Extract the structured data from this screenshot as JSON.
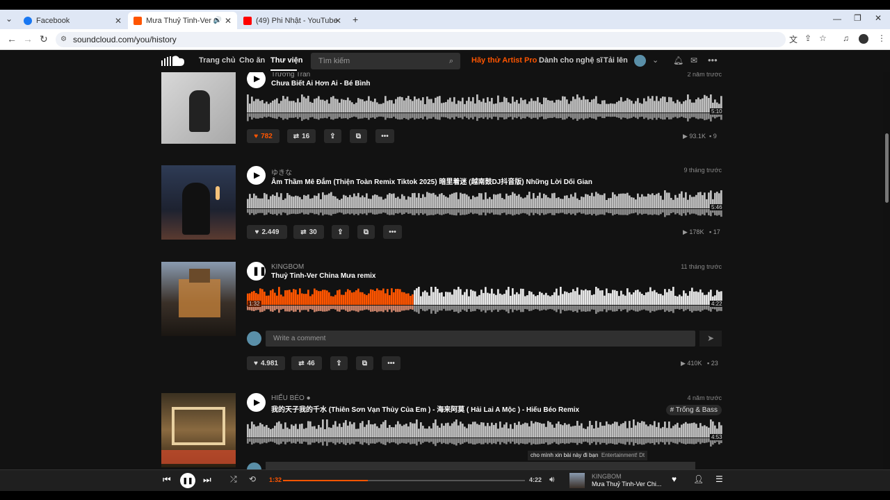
{
  "browser": {
    "tabs": [
      {
        "label": "Facebook"
      },
      {
        "label": "Mưa Thuỷ Tinh-Ver China m"
      },
      {
        "label": "(49) Phi Nhật - YouTube"
      }
    ],
    "url": "soundcloud.com/you/history"
  },
  "nav": {
    "home": "Trang chủ",
    "feed": "Cho ăn",
    "library": "Thư viện",
    "search_placeholder": "Tìm kiếm",
    "artist_pro": "Hãy thử Artist Pro",
    "for_artists": "Dành cho nghệ sĩ",
    "upload": "Tải lên"
  },
  "tracks": [
    {
      "artist": "Trương Trần",
      "title": "Chưa Biết Ai Hơn Ai - Bé Bình",
      "time": "2 năm trước",
      "duration": "5:10",
      "likes": "782",
      "reposts": "16",
      "plays": "93.1K",
      "comments": "9"
    },
    {
      "artist": "ゆきな",
      "title": "Âm Thầm Mê Đắm (Thiện Toàn Remix Tiktok 2025) 暗里着迷 (越南鼓DJ抖音版) Những Lời Dối Gian",
      "time": "9 tháng trước",
      "duration": "5:46",
      "likes": "2.449",
      "reposts": "30",
      "plays": "178K",
      "comments": "17"
    },
    {
      "artist": "KINGBOM",
      "title": "Thuỷ Tinh-Ver China Mưa remix",
      "time": "11 tháng trước",
      "elapsed": "1:32",
      "duration": "4:22",
      "likes": "4.981",
      "reposts": "46",
      "plays": "410K",
      "comments": "23",
      "comment_placeholder": "Write a comment",
      "progress": 0.35
    },
    {
      "artist": "HIẾU BÉO",
      "title": "我的天子我的千水 (Thiên Sơn Vạn Thủy Của Em ) - 海来阿莫 ( Hải Lai A Mộc ) - Hiếu Béo Remix",
      "time": "4 năm trước",
      "duration": "4:53",
      "tag": "# Trống & Bass"
    }
  ],
  "tooltip": {
    "text": "cho mình xin bài này đi bạn",
    "user": "Entertainment! Dt"
  },
  "player": {
    "elapsed": "1:32",
    "total": "4:22",
    "artist": "KINGBOM",
    "title": "Mưa Thuỷ Tinh-Ver Chi...",
    "progress": 0.35
  },
  "colors": {
    "accent": "#ff5500",
    "bg": "#121212"
  }
}
